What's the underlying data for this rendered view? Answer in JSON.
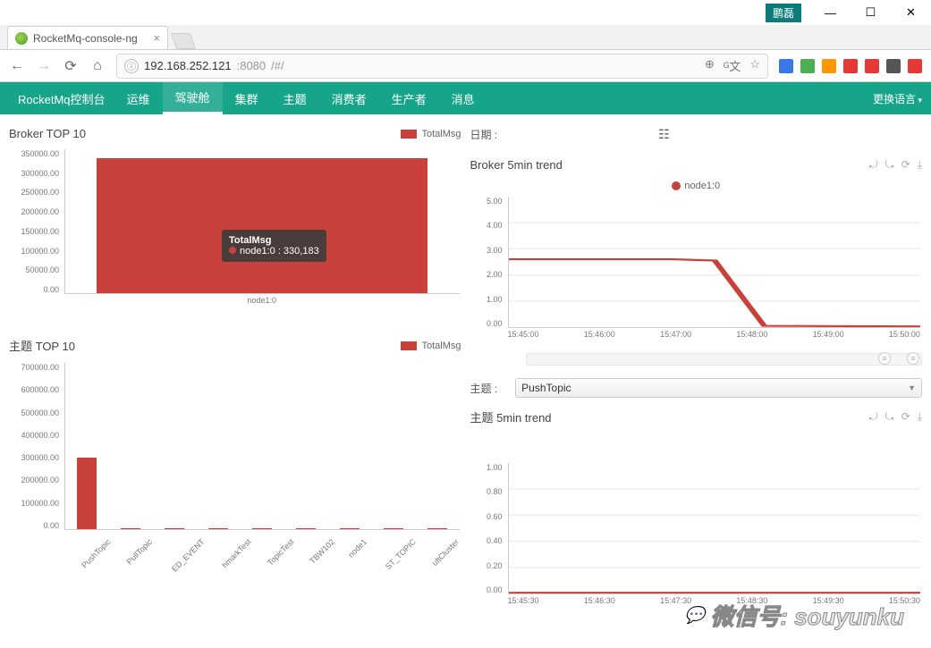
{
  "window": {
    "user_tag": "鹏磊",
    "minimize": "—",
    "maximize": "☐",
    "close": "✕"
  },
  "tab": {
    "title": "RocketMq-console-ng",
    "close": "×"
  },
  "toolbar": {
    "back": "←",
    "forward": "→",
    "reload": "⟳",
    "home": "⌂",
    "url_scheme": "ⓘ",
    "url_host": "192.168.252.121",
    "url_port": ":8080",
    "url_path": "/#/",
    "zoom": "⊕",
    "translate": "ᴳ文",
    "star": "☆"
  },
  "extensions": [
    "A",
    "◐",
    "◎",
    "◉",
    "C",
    "▦",
    "◉"
  ],
  "ext_colors": [
    "#3b78e7",
    "#4caf50",
    "#ff9800",
    "#e53935",
    "#e53935",
    "#555",
    "#e53935"
  ],
  "nav": {
    "brand": "RocketMq控制台",
    "items": [
      "运维",
      "驾驶舱",
      "集群",
      "主题",
      "消费者",
      "生产者",
      "消息"
    ],
    "active_index": 1,
    "lang": "更换语言"
  },
  "right_header": {
    "date_label": "日期 :",
    "calendar_icon": "📅"
  },
  "broker_top10": {
    "title": "Broker TOP 10",
    "legend": "TotalMsg",
    "y_ticks": [
      "350000.00",
      "300000.00",
      "250000.00",
      "200000.00",
      "150000.00",
      "100000.00",
      "50000.00",
      "0.00"
    ],
    "x_ticks": [
      "node1:0"
    ],
    "tooltip_title": "TotalMsg",
    "tooltip_value": "node1:0 : 330,183"
  },
  "broker_trend": {
    "title": "Broker 5min trend",
    "legend": "node1:0",
    "y_ticks": [
      "5.00",
      "4.00",
      "3.00",
      "2.00",
      "1.00",
      "0.00"
    ],
    "x_ticks": [
      "15:45:00",
      "15:46:00",
      "15:47:00",
      "15:48:00",
      "15:49:00",
      "15:50:00"
    ]
  },
  "topic_selector": {
    "label": "主题 :",
    "value": "PushTopic"
  },
  "topic_top10": {
    "title": "主题 TOP 10",
    "legend": "TotalMsg",
    "y_ticks": [
      "700000.00",
      "600000.00",
      "500000.00",
      "400000.00",
      "300000.00",
      "200000.00",
      "100000.00",
      "0.00"
    ],
    "x_ticks": [
      "PushTopic",
      "PullTopic",
      "ED_EVENT",
      "hmarkTest",
      "TopicTest",
      "TBW102",
      "node1",
      "ST_TOPIC",
      "ultCluster"
    ]
  },
  "topic_trend": {
    "title": "主题 5min trend",
    "y_ticks": [
      "1.00",
      "0.80",
      "0.60",
      "0.40",
      "0.20",
      "0.00"
    ],
    "x_ticks": [
      "15:45:30",
      "15:46:30",
      "15:47:30",
      "15:48:30",
      "15:49:30",
      "15:50:30"
    ]
  },
  "chart_icons": [
    "⤾",
    "⤿",
    "⟳",
    "⤓"
  ],
  "watermark": "微信号: souyunku",
  "chart_data": [
    {
      "type": "bar",
      "title": "Broker TOP 10",
      "xlabel": "",
      "ylabel": "",
      "ylim": [
        0,
        350000
      ],
      "categories": [
        "node1:0"
      ],
      "series": [
        {
          "name": "TotalMsg",
          "values": [
            330183
          ]
        }
      ]
    },
    {
      "type": "line",
      "title": "Broker 5min trend",
      "xlabel": "",
      "ylabel": "",
      "ylim": [
        0,
        5
      ],
      "x": [
        "15:45:00",
        "15:46:00",
        "15:47:00",
        "15:47:30",
        "15:48:00",
        "15:49:00",
        "15:50:00"
      ],
      "series": [
        {
          "name": "node1:0",
          "values": [
            2.6,
            2.6,
            2.6,
            2.55,
            0.05,
            0.0,
            0.0
          ]
        }
      ]
    },
    {
      "type": "bar",
      "title": "主题 TOP 10",
      "xlabel": "",
      "ylabel": "",
      "ylim": [
        0,
        700000
      ],
      "categories": [
        "PushTopic",
        "PullTopic",
        "ED_EVENT",
        "hmarkTest",
        "TopicTest",
        "TBW102",
        "node1",
        "ST_TOPIC",
        "ultCluster"
      ],
      "series": [
        {
          "name": "TotalMsg",
          "values": [
            300000,
            5000,
            3000,
            3000,
            3000,
            2000,
            2000,
            2000,
            2000
          ]
        }
      ]
    },
    {
      "type": "line",
      "title": "主题 5min trend",
      "xlabel": "",
      "ylabel": "",
      "ylim": [
        0,
        1
      ],
      "x": [
        "15:45:30",
        "15:46:30",
        "15:47:30",
        "15:48:30",
        "15:49:30",
        "15:50:30"
      ],
      "series": [
        {
          "name": "PushTopic",
          "values": [
            0,
            0,
            0,
            0,
            0,
            0
          ]
        }
      ]
    }
  ]
}
